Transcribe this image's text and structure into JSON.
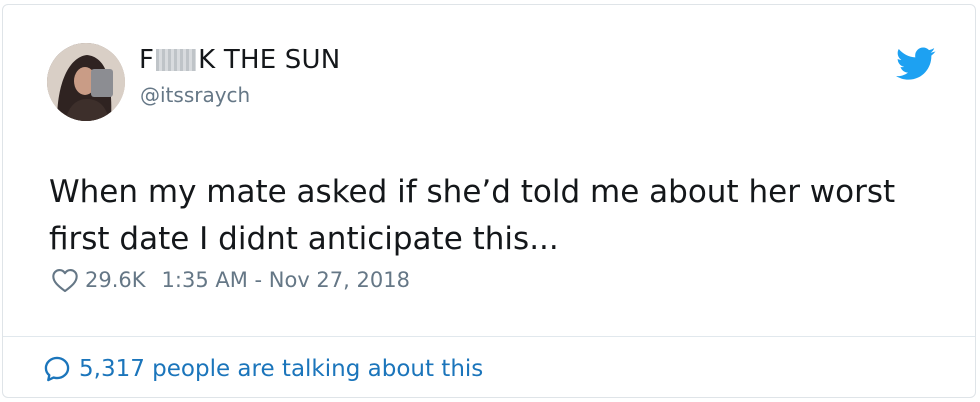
{
  "tweet": {
    "display_name_start": "F",
    "display_name_end": "K THE SUN",
    "handle": "@itssraych",
    "text": "When my mate asked if she’d told me about her worst first date I didnt anticipate this...",
    "likes": "29.6K",
    "timestamp": "1:35 AM - Nov 27, 2018",
    "talking": "5,317 people are talking about this"
  },
  "icons": {
    "brand": "twitter-bird-icon",
    "like": "heart-icon",
    "reply": "speech-bubble-icon"
  },
  "colors": {
    "brand_blue": "#1da1f2",
    "link_blue": "#1b75bb",
    "text": "#14171a",
    "muted": "#657786",
    "border": "#dfe4e8"
  }
}
